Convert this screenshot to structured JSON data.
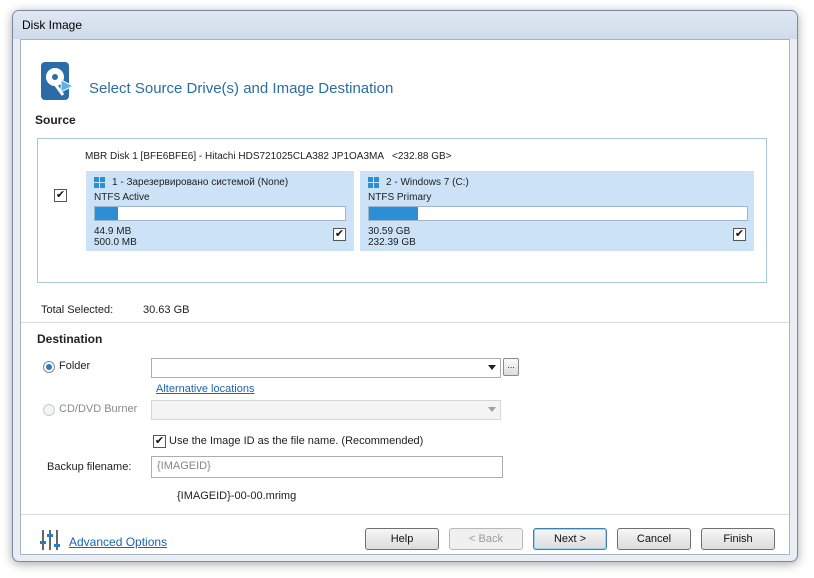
{
  "window": {
    "title": "Disk Image"
  },
  "header": {
    "title": "Select Source Drive(s) and Image Destination"
  },
  "source": {
    "label": "Source",
    "disk": {
      "name": "MBR Disk 1 [BFE6BFE6] - Hitachi HDS721025CLA382 JP1OA3MA",
      "size": "<232.88 GB>",
      "checked": true
    },
    "partitions": [
      {
        "name": "1 - Зарезервировано системой (None)",
        "fs": "NTFS Active",
        "used": "44.9 MB",
        "total": "500.0 MB",
        "fill_fraction": 0.09,
        "checked": true
      },
      {
        "name": "2 - Windows 7 (C:)",
        "fs": "NTFS Primary",
        "used": "30.59 GB",
        "total": "232.39 GB",
        "fill_fraction": 0.13,
        "checked": true
      }
    ],
    "total_label": "Total Selected:",
    "total_value": "30.63 GB"
  },
  "destination": {
    "label": "Destination",
    "folder_label": "Folder",
    "folder_value": "",
    "browse_label": "...",
    "alt_link": "Alternative locations",
    "cd_label": "CD/DVD Burner",
    "use_id_label": "Use the Image ID as the file name.  (Recommended)",
    "backup_label": "Backup filename:",
    "backup_value": "{IMAGEID}",
    "preview": "{IMAGEID}-00-00.mrimg"
  },
  "footer": {
    "advanced": "Advanced Options",
    "help": "Help",
    "back": "< Back",
    "next": "Next >",
    "cancel": "Cancel",
    "finish": "Finish"
  },
  "colors": {
    "accent": "#2a6ea5",
    "partition_bg": "#cce3f7",
    "bar_fill": "#2c8fd6",
    "link": "#1a64b0"
  }
}
